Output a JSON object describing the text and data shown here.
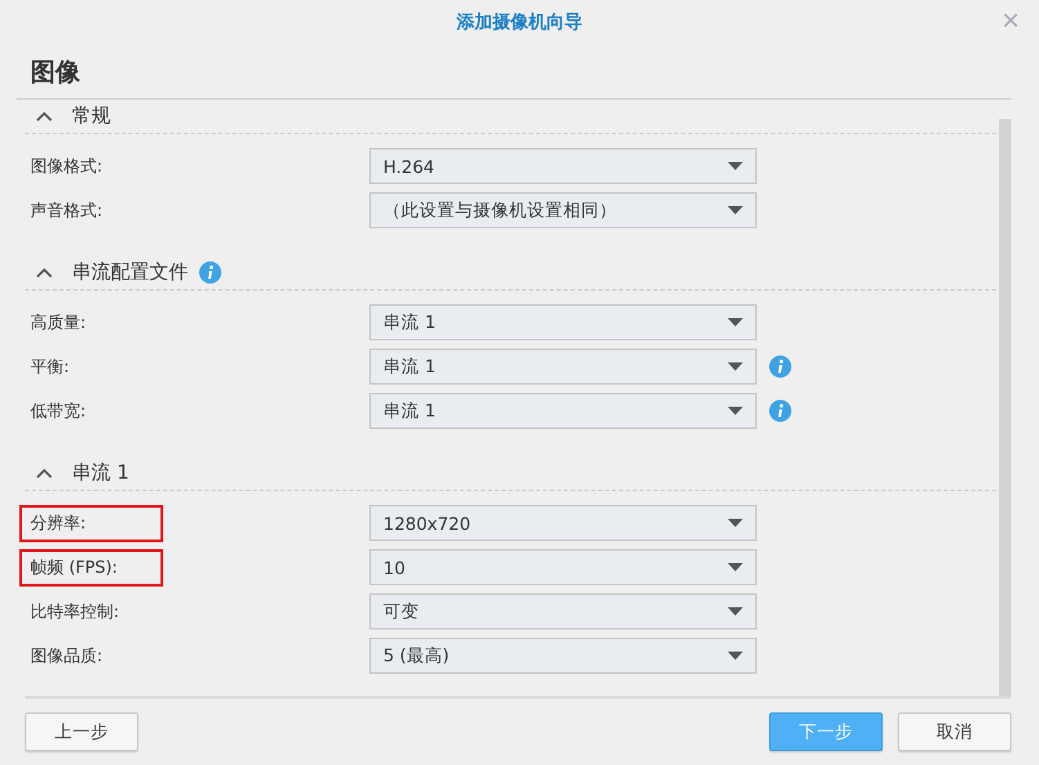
{
  "window": {
    "title": "添加摄像机向导",
    "close": "×"
  },
  "heading": "图像",
  "sections": [
    {
      "title": "常规",
      "expanded": true,
      "info": false,
      "rows": [
        {
          "label": "图像格式:",
          "value": "H.264",
          "info": false,
          "highlighted": false
        },
        {
          "label": "声音格式:",
          "value": "（此设置与摄像机设置相同）",
          "info": false,
          "highlighted": false
        }
      ]
    },
    {
      "title": "串流配置文件",
      "expanded": true,
      "info": true,
      "rows": [
        {
          "label": "高质量:",
          "value": "串流 1",
          "info": false,
          "highlighted": false
        },
        {
          "label": "平衡:",
          "value": "串流 1",
          "info": true,
          "highlighted": false
        },
        {
          "label": "低带宽:",
          "value": "串流 1",
          "info": true,
          "highlighted": false
        }
      ]
    },
    {
      "title": "串流 1",
      "expanded": true,
      "info": false,
      "rows": [
        {
          "label": "分辨率:",
          "value": "1280x720",
          "info": false,
          "highlighted": true
        },
        {
          "label": "帧频 (FPS):",
          "value": "10",
          "info": false,
          "highlighted": true
        },
        {
          "label": "比特率控制:",
          "value": "可变",
          "info": false,
          "highlighted": false
        },
        {
          "label": "图像品质:",
          "value": "5 (最高)",
          "info": false,
          "highlighted": false
        }
      ]
    }
  ],
  "buttons": [
    {
      "label": "上一步",
      "kind": "secondary"
    },
    {
      "label": "下一步",
      "kind": "primary"
    },
    {
      "label": "取消",
      "kind": "secondary"
    }
  ]
}
